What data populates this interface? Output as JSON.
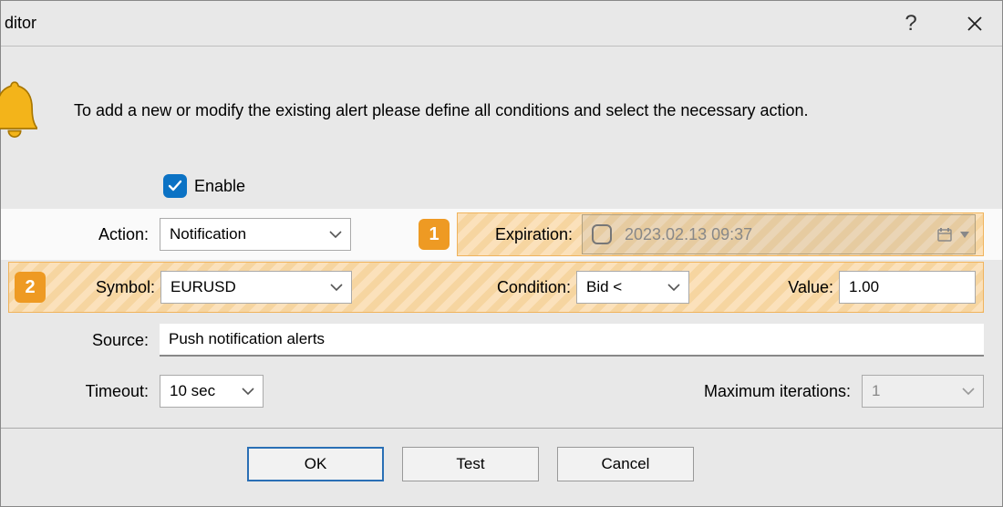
{
  "title": "ditor",
  "intro": "To add a new or modify the existing alert please define all conditions and select the necessary action.",
  "enable_label": "Enable",
  "enable_checked": true,
  "action_label": "Action:",
  "action_value": "Notification",
  "badge1": "1",
  "expiration_label": "Expiration:",
  "expiration_value": "2023.02.13 09:37",
  "expiration_enabled": false,
  "badge2": "2",
  "symbol_label": "Symbol:",
  "symbol_value": "EURUSD",
  "condition_label": "Condition:",
  "condition_value": "Bid <",
  "value_label": "Value:",
  "value_value": "1.00",
  "source_label": "Source:",
  "source_value": "Push notification alerts",
  "timeout_label": "Timeout:",
  "timeout_value": "10 sec",
  "maxiter_label": "Maximum iterations:",
  "maxiter_value": "1",
  "ok_label": "OK",
  "test_label": "Test",
  "cancel_label": "Cancel"
}
